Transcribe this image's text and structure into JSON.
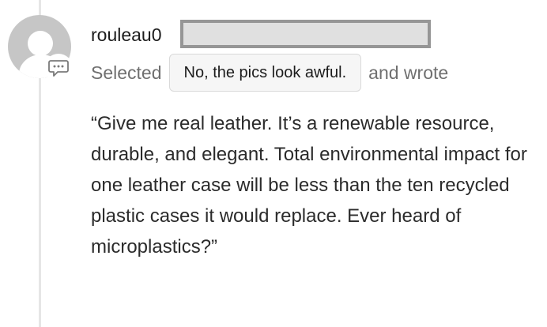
{
  "comment": {
    "username": "rouleau0",
    "action_prefix": "Selected",
    "selected_option": "No, the pics look awful.",
    "action_suffix": "and wrote",
    "body": "“Give me real leather. It’s a renewable resource, durable, and elegant. Total environmental impact for one leather case will be less than the ten recycled plastic cases it would replace. Ever heard of microplastics?”"
  },
  "icons": {
    "avatar": "default-user-avatar-icon",
    "badge": "speech-bubble-ellipsis-icon"
  },
  "colors": {
    "avatar_gray": "#c6c6c6",
    "muted_text": "#6f6f6f",
    "body_text": "#2b2b2b",
    "redaction_border": "#969696"
  }
}
